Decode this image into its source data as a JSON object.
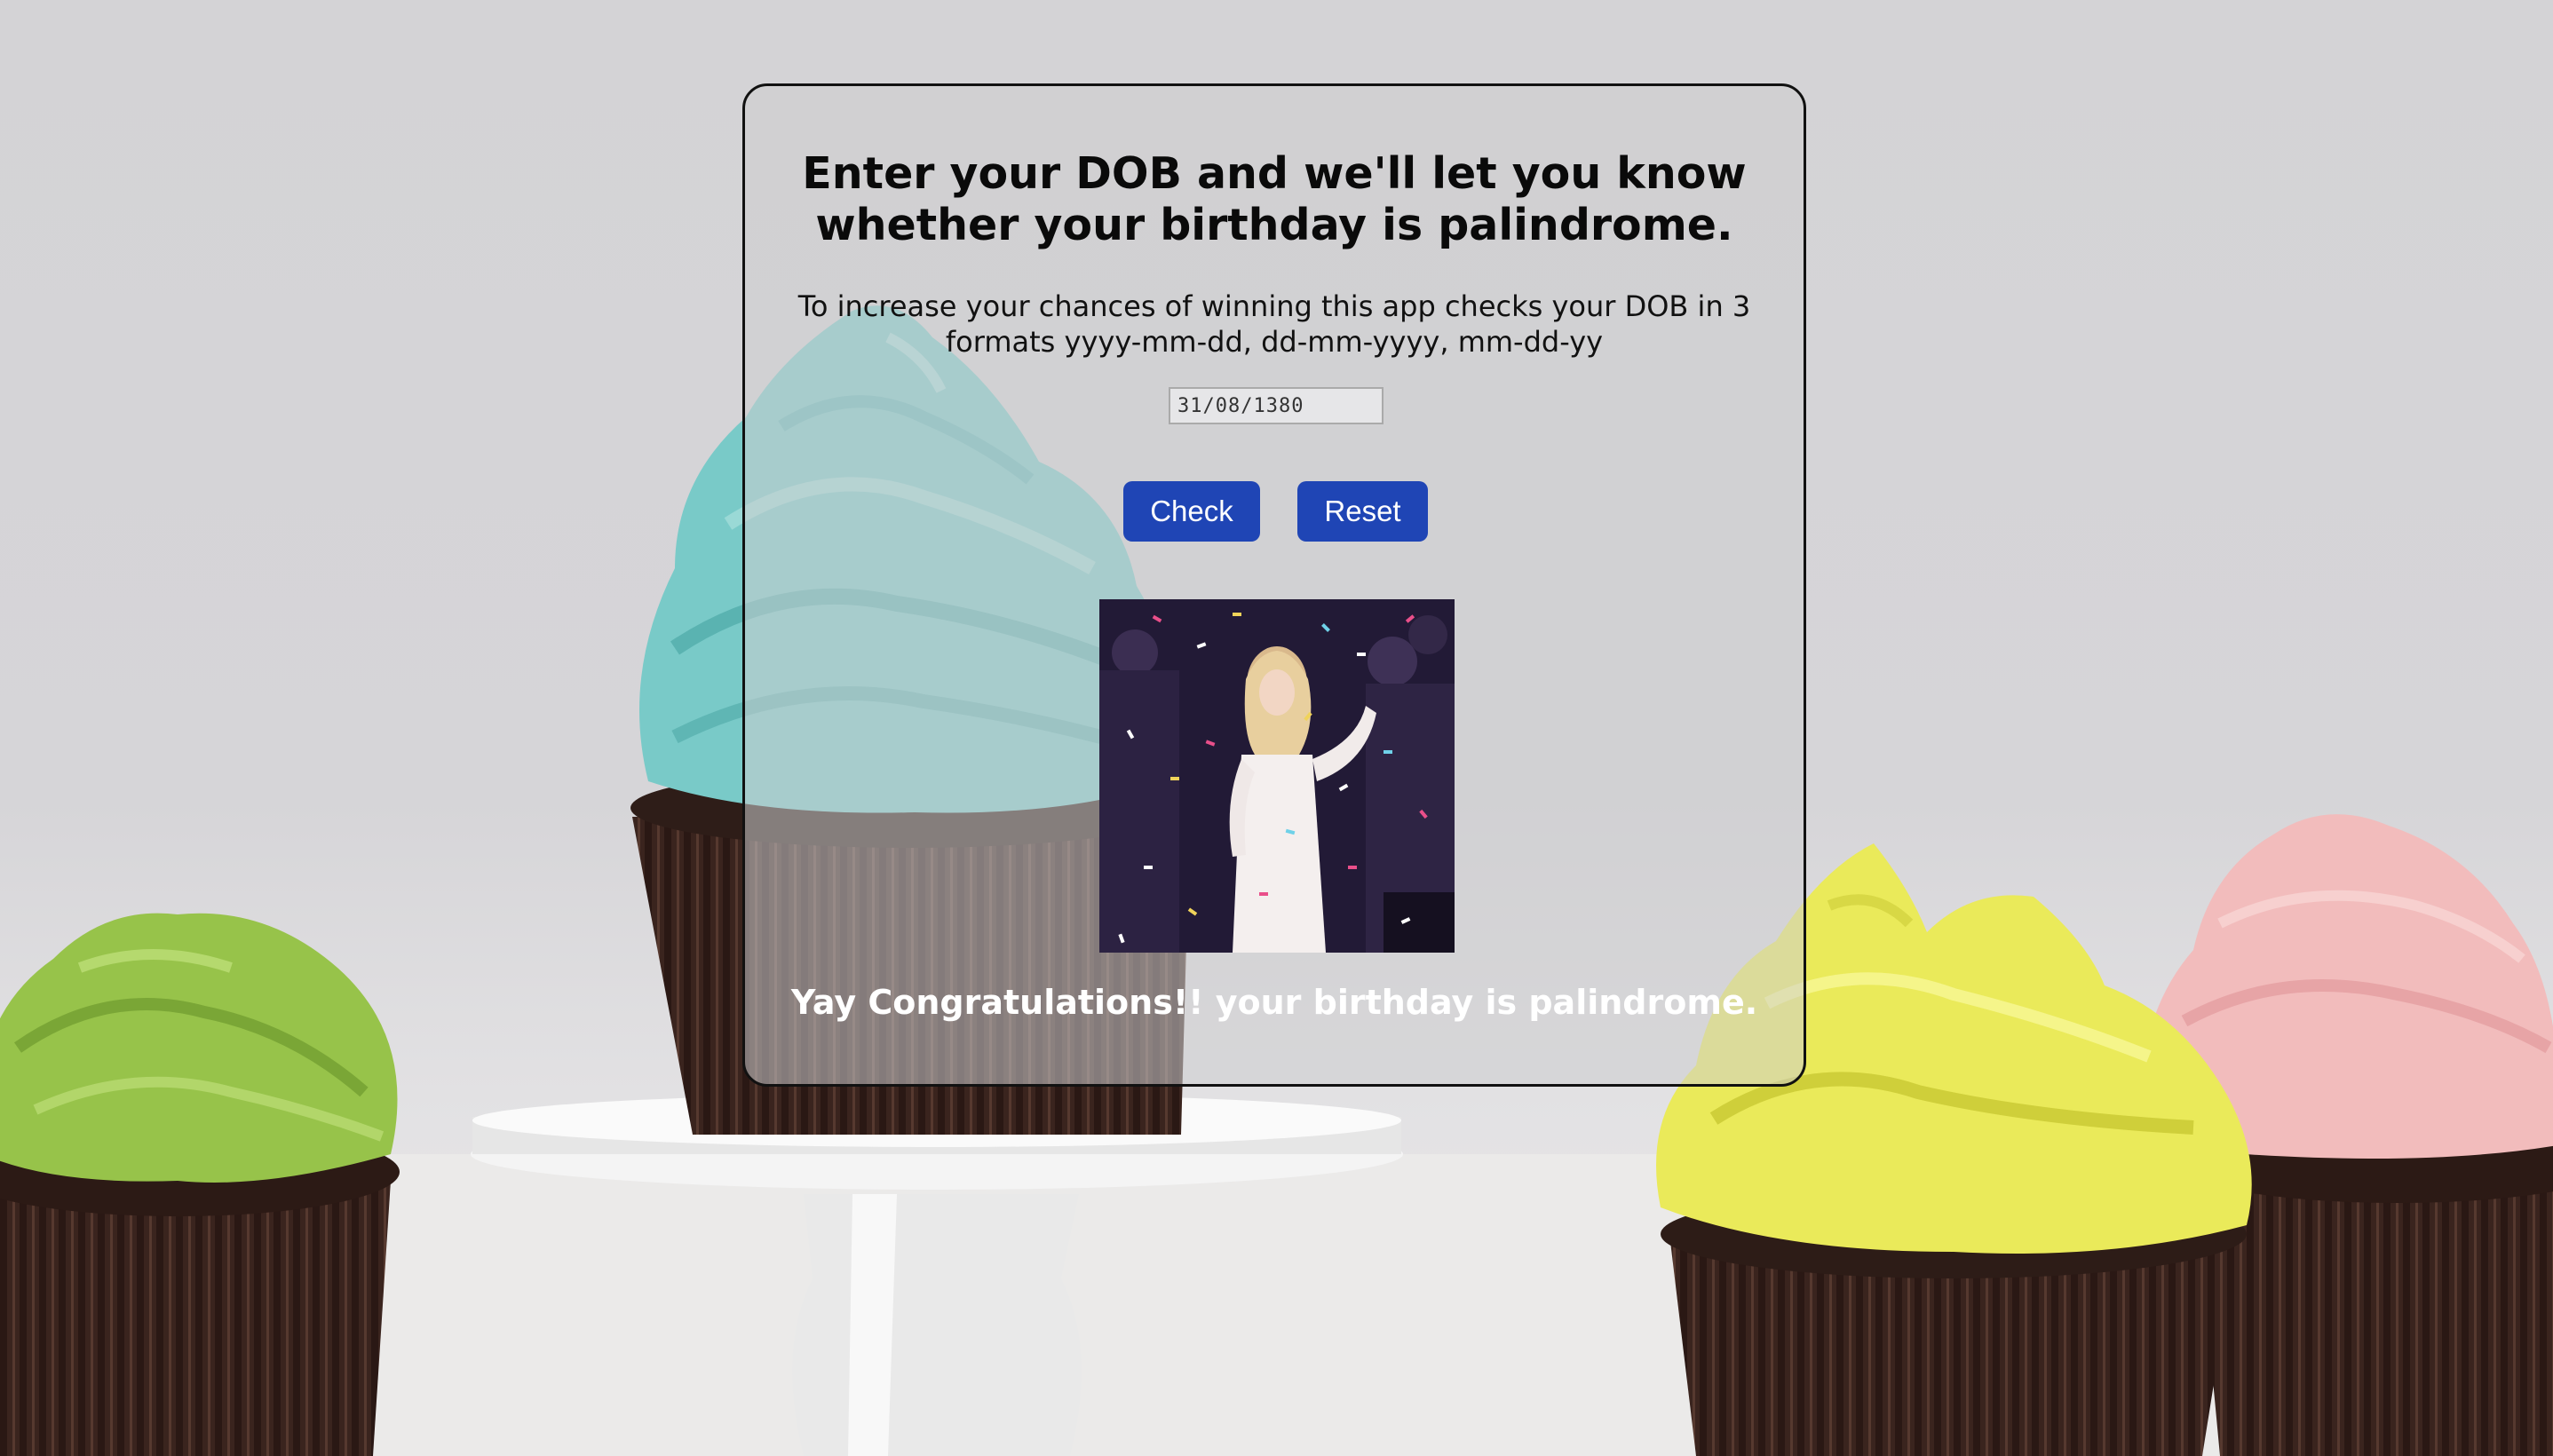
{
  "heading": {
    "line1": "Enter your DOB and we'll let you know",
    "line2": "whether your birthday is palindrome."
  },
  "subtext": {
    "line1": "To increase your chances of winning this app checks your DOB in 3",
    "line2": "formats yyyy-mm-dd, dd-mm-yyyy, mm-dd-yy"
  },
  "dob_input": {
    "value": "31/08/1380"
  },
  "buttons": {
    "check": "Check",
    "reset": "Reset"
  },
  "result": {
    "message": "Yay Congratulations!! your birthday is palindrome."
  },
  "colors": {
    "button": "#1f45b5",
    "panel_border": "#111111"
  }
}
